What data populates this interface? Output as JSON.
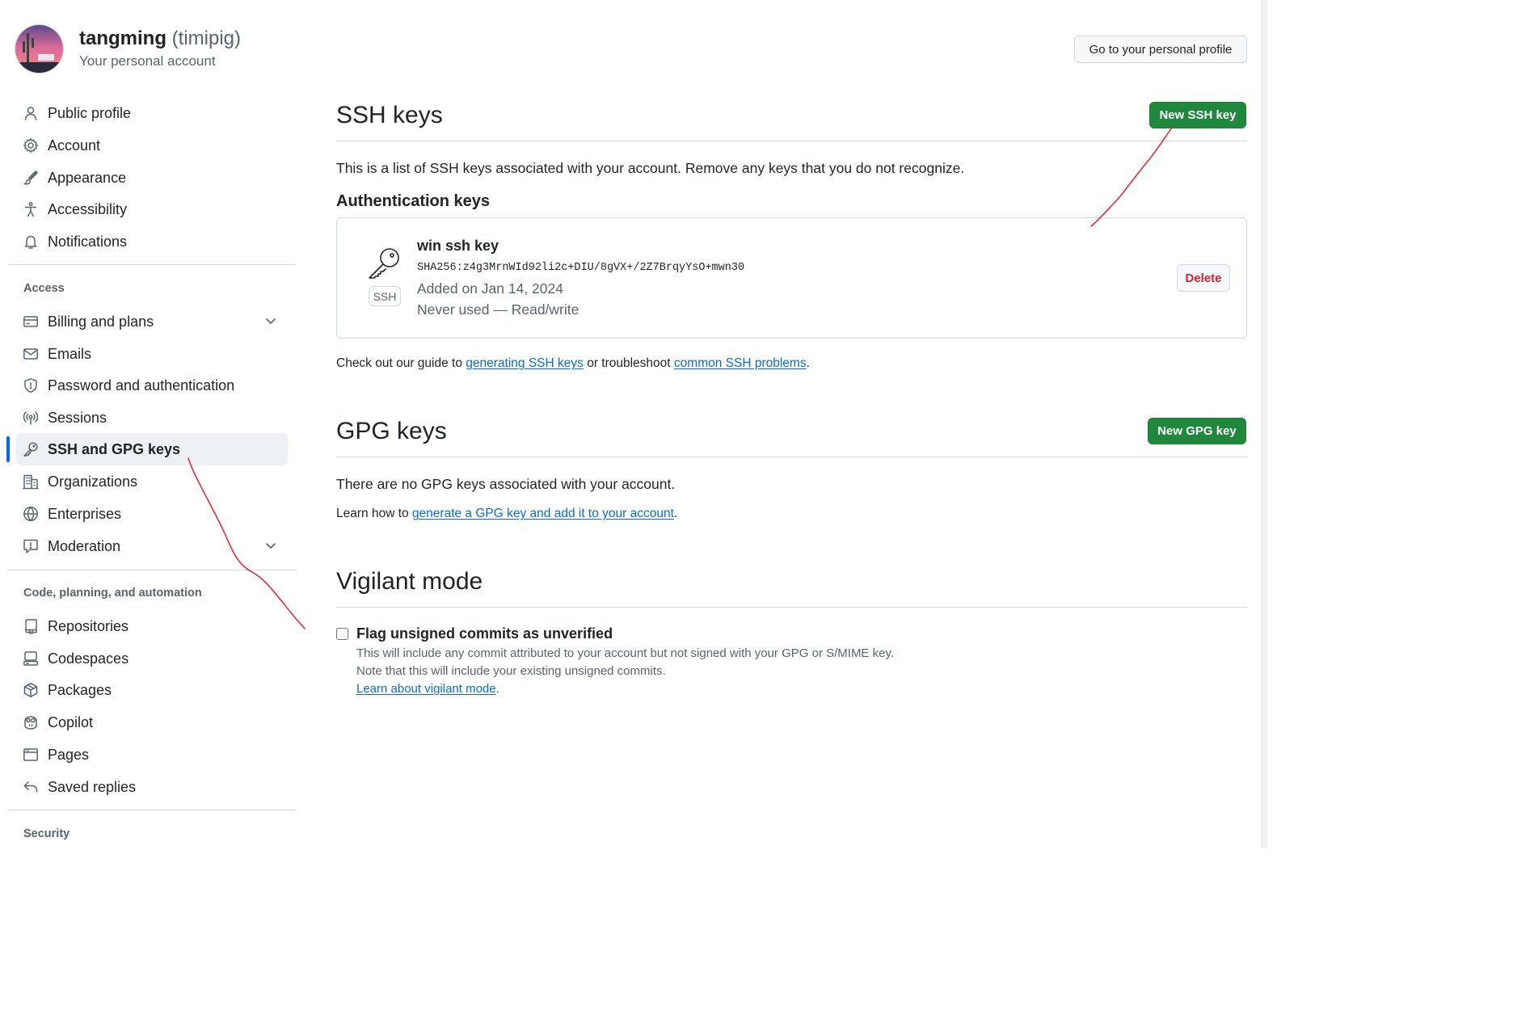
{
  "account": {
    "name": "tangming",
    "login": "(timipig)",
    "subtitle": "Your personal account",
    "profile_button": "Go to your personal profile"
  },
  "sidebar": {
    "items": [
      {
        "label": "Public profile",
        "icon": "person-icon"
      },
      {
        "label": "Account",
        "icon": "gear-icon"
      },
      {
        "label": "Appearance",
        "icon": "paintbrush-icon"
      },
      {
        "label": "Accessibility",
        "icon": "accessibility-icon"
      },
      {
        "label": "Notifications",
        "icon": "bell-icon"
      }
    ],
    "access_heading": "Access",
    "access_items": [
      {
        "label": "Billing and plans",
        "icon": "credit-card-icon"
      },
      {
        "label": "Emails",
        "icon": "mail-icon"
      },
      {
        "label": "Password and authentication",
        "icon": "shield-icon"
      },
      {
        "label": "Sessions",
        "icon": "broadcast-icon"
      },
      {
        "label": "SSH and GPG keys",
        "icon": "key-icon",
        "active": true
      },
      {
        "label": "Organizations",
        "icon": "organization-icon"
      },
      {
        "label": "Enterprises",
        "icon": "globe-icon"
      },
      {
        "label": "Moderation",
        "icon": "report-icon"
      }
    ],
    "code_heading": "Code, planning, and automation",
    "code_items": [
      {
        "label": "Repositories",
        "icon": "repo-icon"
      },
      {
        "label": "Codespaces",
        "icon": "codespaces-icon"
      },
      {
        "label": "Packages",
        "icon": "package-icon"
      },
      {
        "label": "Copilot",
        "icon": "copilot-icon"
      },
      {
        "label": "Pages",
        "icon": "browser-icon"
      },
      {
        "label": "Saved replies",
        "icon": "reply-icon"
      }
    ],
    "security_heading": "Security"
  },
  "ssh": {
    "title": "SSH keys",
    "new_button": "New SSH key",
    "description": "This is a list of SSH keys associated with your account. Remove any keys that you do not recognize.",
    "auth_heading": "Authentication keys",
    "key": {
      "badge": "SSH",
      "title": "win ssh key",
      "fingerprint": "SHA256:z4g3MrnWId92li2c+DIU/8gVX+/2Z7BrqyYsO+mwn30",
      "added": "Added on Jan 14, 2024",
      "usage": "Never used — Read/write",
      "delete_button": "Delete"
    },
    "guide": {
      "prefix": "Check out our guide to ",
      "link1": "generating SSH keys",
      "middle": " or troubleshoot ",
      "link2": "common SSH problems",
      "suffix": "."
    }
  },
  "gpg": {
    "title": "GPG keys",
    "new_button": "New GPG key",
    "empty": "There are no GPG keys associated with your account.",
    "learn_prefix": "Learn how to ",
    "learn_link": "generate a GPG key and add it to your account",
    "learn_suffix": "."
  },
  "vigilant": {
    "title": "Vigilant mode",
    "checkbox_label": "Flag unsigned commits as unverified",
    "checked": false,
    "note1": "This will include any commit attributed to your account but not signed with your GPG or S/MIME key.",
    "note2": "Note that this will include your existing unsigned commits.",
    "link": "Learn about vigilant mode",
    "link_suffix": "."
  },
  "colors": {
    "accent": "#0969da",
    "primary_button": "#1f883d",
    "danger": "#d1242f",
    "annotation": "#e8202a"
  }
}
